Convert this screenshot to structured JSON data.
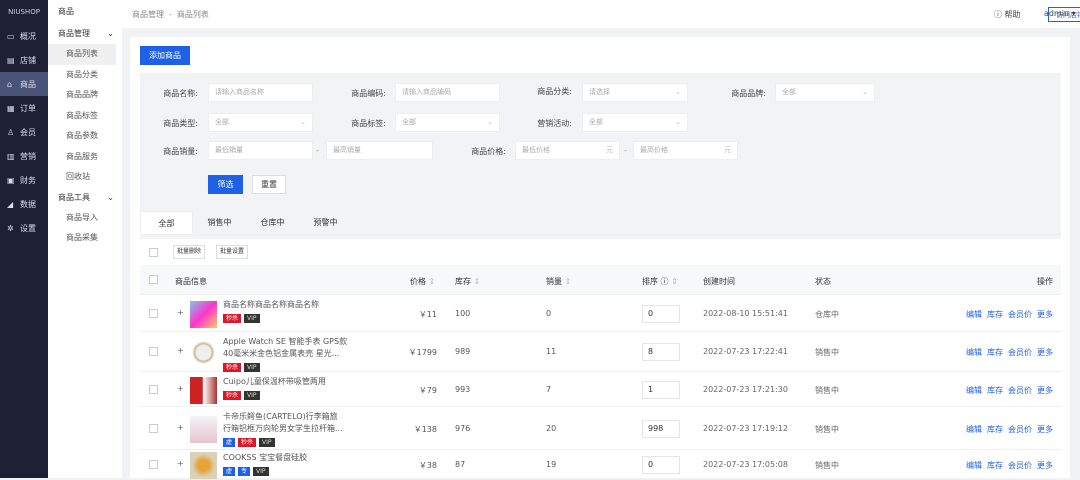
{
  "brand": "NIUSHOP",
  "nav": [
    {
      "label": "概况",
      "icon": "overview-icon"
    },
    {
      "label": "店铺",
      "icon": "shop-icon"
    },
    {
      "label": "商品",
      "icon": "goods-icon"
    },
    {
      "label": "订单",
      "icon": "order-icon"
    },
    {
      "label": "会员",
      "icon": "member-icon"
    },
    {
      "label": "营销",
      "icon": "marketing-icon"
    },
    {
      "label": "财务",
      "icon": "finance-icon"
    },
    {
      "label": "数据",
      "icon": "data-icon"
    },
    {
      "label": "设置",
      "icon": "settings-icon"
    }
  ],
  "sub": {
    "title": "商品",
    "group1": "商品管理",
    "items1": [
      "商品列表",
      "商品分类",
      "商品品牌",
      "商品标签",
      "商品参数",
      "商品服务",
      "回收站"
    ],
    "group2": "商品工具",
    "items2": [
      "商品导入",
      "商品采集"
    ]
  },
  "header": {
    "crumb1": "商品管理",
    "sep": "-",
    "crumb2": "商品列表",
    "visit": "访问店铺",
    "help": "帮助",
    "user": "admin"
  },
  "add_button": "添加商品",
  "filters": {
    "name_label": "商品名称:",
    "name_ph": "请输入商品名称",
    "code_label": "商品编码:",
    "code_ph": "请输入商品编码",
    "cat_label": "商品分类:",
    "cat_val": "请选择",
    "brand_label": "商品品牌:",
    "brand_val": "全部",
    "type_label": "商品类型:",
    "type_val": "全部",
    "tag_label": "商品标签:",
    "tag_val": "全部",
    "promo_label": "营销活动:",
    "promo_val": "全部",
    "sales_label": "商品销量:",
    "sales_min": "最低销量",
    "sales_max": "最高销量",
    "dash": "-",
    "price_label": "商品价格:",
    "price_min": "最低价格",
    "price_max": "最高价格",
    "unit": "元",
    "filter_btn": "筛选",
    "reset_btn": "重置"
  },
  "tabs": [
    "全部",
    "销售中",
    "仓库中",
    "预警中"
  ],
  "batch": [
    "批量删除",
    "批量设置"
  ],
  "columns": {
    "info": "商品信息",
    "price": "价格",
    "stock": "库存",
    "sales": "销量",
    "sort": "排序",
    "time": "创建时间",
    "status": "状态",
    "ops": "操作"
  },
  "rows": [
    {
      "name1": "商品名称商品名称商品名称",
      "name2": "",
      "tags": [
        [
          "秒杀",
          "red"
        ],
        [
          "VIP",
          "dark"
        ]
      ],
      "price": "￥11",
      "stock": "100",
      "sales": "0",
      "sort": "0",
      "time": "2022-08-10 15:51:41",
      "status": "仓库中"
    },
    {
      "name1": "Apple Watch SE 智能手表 GPS款",
      "name2": "40毫米米金色铝金属表壳 星光...",
      "tags": [
        [
          "秒杀",
          "red"
        ],
        [
          "VIP",
          "dark"
        ]
      ],
      "price": "￥1799",
      "stock": "989",
      "sales": "11",
      "sort": "8",
      "time": "2022-07-23 17:22:41",
      "status": "销售中"
    },
    {
      "name1": "Cuipo儿童保温杯带吸管两用",
      "name2": "",
      "tags": [
        [
          "秒杀",
          "red"
        ],
        [
          "VIP",
          "dark"
        ]
      ],
      "price": "￥79",
      "stock": "993",
      "sales": "7",
      "sort": "1",
      "time": "2022-07-23 17:21:30",
      "status": "销售中"
    },
    {
      "name1": "卡帝乐鳄鱼(CARTELO)行李箱旅",
      "name2": "行箱铝框万向轮男女学生拉杆箱...",
      "tags": [
        [
          "虚",
          "blue"
        ],
        [
          "秒杀",
          "red"
        ],
        [
          "VIP",
          "dark"
        ]
      ],
      "price": "￥138",
      "stock": "976",
      "sales": "20",
      "sort": "998",
      "time": "2022-07-23 17:19:12",
      "status": "销售中"
    },
    {
      "name1": "COOKSS 宝宝餐盘硅胶",
      "name2": "",
      "tags": [
        [
          "虚",
          "blue"
        ],
        [
          "专",
          "blue"
        ],
        [
          "VIP",
          "dark"
        ]
      ],
      "price": "￥38",
      "stock": "87",
      "sales": "19",
      "sort": "0",
      "time": "2022-07-23 17:05:08",
      "status": "销售中"
    }
  ],
  "ops": [
    "编辑",
    "库存",
    "会员价",
    "更多"
  ]
}
